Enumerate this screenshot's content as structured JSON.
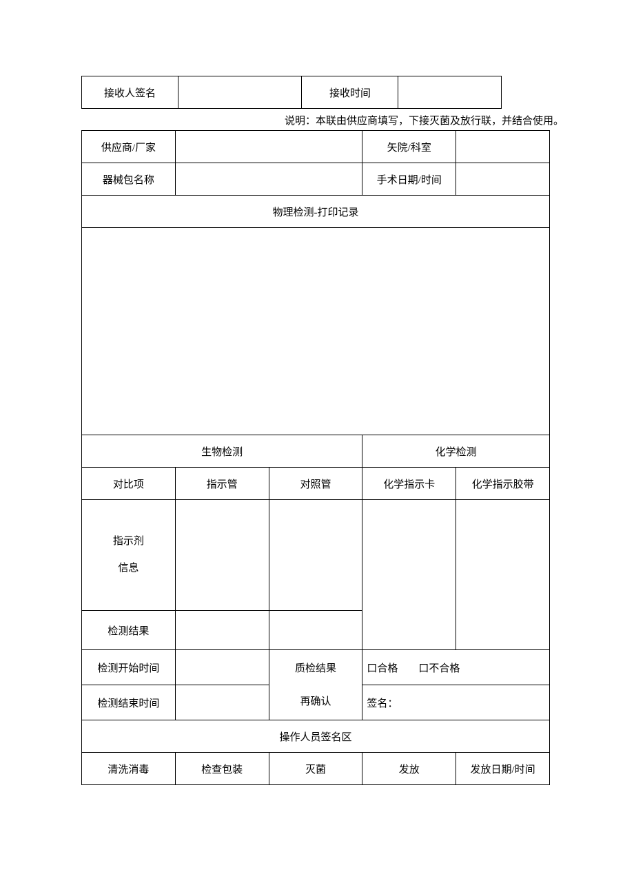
{
  "top": {
    "receiver_signature_label": "接收人签名",
    "receive_time_label": "接收时间"
  },
  "note": "说明：本联由供应商填写，下接灭菌及放行联，并结合使用。",
  "header": {
    "supplier_label": "供应商/厂家",
    "hospital_label": "矢院/科室",
    "package_name_label": "器械包名称",
    "surgery_time_label": "手术日期/时间"
  },
  "physical_section_title": "物理检测-打印记录",
  "bio_section_title": "生物检测",
  "chem_section_title": "化学检测",
  "columns": {
    "compare_item": "对比项",
    "indicator_tube": "指示管",
    "control_tube": "对照管",
    "chem_card": "化学指示卡",
    "chem_tape": "化学指示胶带"
  },
  "rows": {
    "indicator_line1": "指示剂",
    "indicator_line2": "信息",
    "detection_result": "检测结果",
    "detection_start": "检测开始时间",
    "detection_end": "检测结束时间",
    "qc_result_label": "质检结果",
    "reconfirm_label": "再确认",
    "qc_options": "口合格  口不合格",
    "signature_label": "签名："
  },
  "operator_section_title": "操作人员签名区",
  "operator_cols": {
    "clean": "清洗消毒",
    "inspect": "检查包装",
    "sterilize": "灭菌",
    "release": "发放",
    "release_time": "发放日期/时间"
  }
}
